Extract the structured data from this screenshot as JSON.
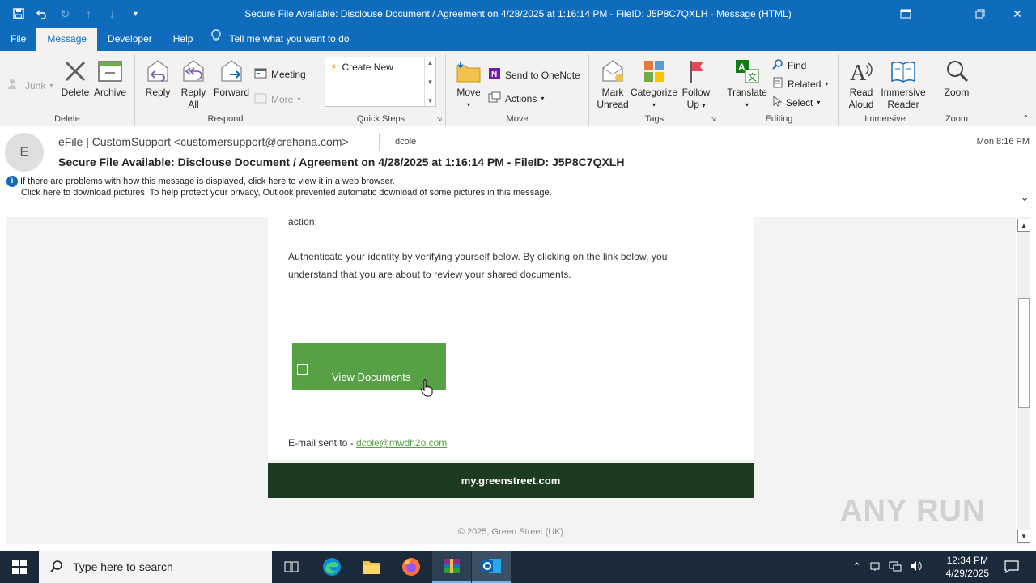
{
  "window": {
    "title": "Secure File Available: Disclouse Document / Agreement on 4/28/2025 at 1:16:14 PM - FileID: J5P8C7QXLH  -  Message (HTML)"
  },
  "ribbon_tabs": [
    "File",
    "Message",
    "Developer",
    "Help"
  ],
  "tell_me": "Tell me what you want to do",
  "ribbon": {
    "delete_group": {
      "label": "Delete",
      "junk": "Junk",
      "delete": "Delete",
      "archive": "Archive"
    },
    "respond_group": {
      "label": "Respond",
      "reply": "Reply",
      "reply_all_1": "Reply",
      "reply_all_2": "All",
      "forward": "Forward",
      "meeting": "Meeting",
      "more": "More"
    },
    "quick_steps_group": {
      "label": "Quick Steps",
      "create_new": "Create New"
    },
    "move_group": {
      "label": "Move",
      "move": "Move",
      "send_onenote": "Send to OneNote",
      "actions": "Actions"
    },
    "tags_group": {
      "label": "Tags",
      "mark_unread_1": "Mark",
      "mark_unread_2": "Unread",
      "categorize": "Categorize",
      "follow_up_1": "Follow",
      "follow_up_2": "Up"
    },
    "editing_group": {
      "label": "Editing",
      "translate": "Translate",
      "find": "Find",
      "related": "Related",
      "select": "Select"
    },
    "immersive_group": {
      "label": "Immersive",
      "read_aloud_1": "Read",
      "read_aloud_2": "Aloud",
      "immersive_reader_1": "Immersive",
      "immersive_reader_2": "Reader"
    },
    "zoom_group": {
      "label": "Zoom",
      "zoom": "Zoom"
    }
  },
  "message": {
    "avatar_initial": "E",
    "sender": "eFile | CustomSupport <customersupport@crehana.com>",
    "to": "dcole",
    "date": "Mon 8:16 PM",
    "subject": "Secure File Available: Disclouse Document / Agreement on 4/28/2025 at 1:16:14 PM - FileID: J5P8C7QXLH",
    "info_line1": "If there are problems with how this message is displayed, click here to view it in a web browser.",
    "info_line2": "Click here to download pictures. To help protect your privacy, Outlook prevented automatic download of some pictures in this message."
  },
  "body": {
    "line_action": "action.",
    "paragraph1": "Authenticate your identity by verifying yourself below. By clicking on the link below, you",
    "paragraph2": "understand that you are about to review your shared documents.",
    "cta_label": "View Documents",
    "email_prefix": "E-mail sent to - ",
    "email_link": "dcole@mwdh2o.com",
    "footer_site": "my.greenstreet.com",
    "copyright": "© 2025, Green Street (UK)"
  },
  "watermark": "ANY RUN",
  "taskbar": {
    "search_placeholder": "Type here to search",
    "time": "12:34 PM",
    "date": "4/29/2025"
  },
  "colors": {
    "accent": "#0f6cbd",
    "cta_green": "#58a046",
    "footer_dark_green": "#1c3b1f"
  }
}
